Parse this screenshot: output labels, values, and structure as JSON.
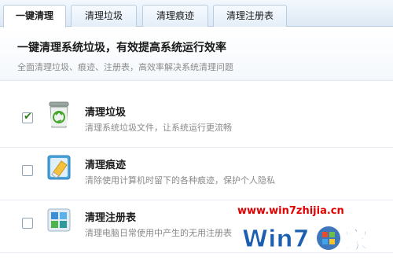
{
  "tabs": [
    {
      "label": "一键清理"
    },
    {
      "label": "清理垃圾"
    },
    {
      "label": "清理痕迹"
    },
    {
      "label": "清理注册表"
    }
  ],
  "header": {
    "title": "一键清理系统垃圾，有效提高系统运行效率",
    "subtitle": "全面清理垃圾、痕迹、注册表，高效率解决系统清理问题"
  },
  "items": [
    {
      "title": "清理垃圾",
      "desc": "清理系统垃圾文件，让系统运行更流畅",
      "checked": true,
      "icon": "recycle-bin-icon"
    },
    {
      "title": "清理痕迹",
      "desc": "清除使用计算机时留下的各种痕迹，保护个人隐私",
      "checked": false,
      "icon": "eraser-icon"
    },
    {
      "title": "清理注册表",
      "desc": "清理电脑日常使用中产生的无用注册表",
      "checked": false,
      "icon": "registry-icon"
    }
  ],
  "watermark": {
    "url": "www.win7zhijia.cn",
    "brand": "Win7之家"
  },
  "colors": {
    "accent": "#2f7d16",
    "watermark_red": "#e00000",
    "watermark_blue": "#1c5fb0"
  }
}
